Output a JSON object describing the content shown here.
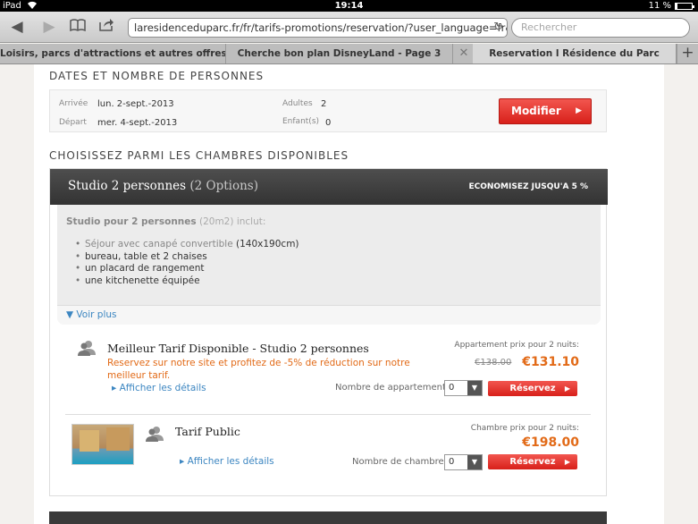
{
  "statusbar": {
    "device": "iPad",
    "time": "19:14",
    "battery": "11 %",
    "battery_level": 0.11
  },
  "toolbar": {
    "url": "laresidenceduparc.fr/fr/tarifs-promotions/reservation/?user_language=fr&",
    "search_placeholder": "Rechercher"
  },
  "tabs": [
    {
      "label": "Loisirs, parcs d'attractions et autres offres -..."
    },
    {
      "label": "Cherche bon plan DisneyLand - Page 3"
    },
    {
      "label": "Reservation l Résidence du Parc"
    }
  ],
  "dates": {
    "section_title": "DATES ET NOMBRE DE PERSONNES",
    "arrival_label": "Arrivée",
    "arrival_value": "lun. 2-sept.-2013",
    "departure_label": "Départ",
    "departure_value": "mer. 4-sept.-2013",
    "adults_label": "Adultes",
    "adults_value": "2",
    "children_label": "Enfant(s)",
    "children_value": "0",
    "modify_label": "Modifier"
  },
  "rooms": {
    "section_title": "CHOISISSEZ PARMI LES CHAMBRES DISPONIBLES",
    "header_title": "Studio 2 personnes",
    "header_options": "(2 Options)",
    "header_promo": "ECONOMISEZ JUSQU'A 5 %",
    "desc_name": "Studio pour 2 personnes",
    "desc_size": "(20m2)",
    "desc_suffix": "inclut:",
    "features": [
      {
        "a": "Séjour avec canapé convertible",
        "b": " (140x190cm)"
      },
      {
        "a": "",
        "b": "bureau, table et 2 chaises"
      },
      {
        "a": "",
        "b": "un placard de rangement"
      },
      {
        "a": "",
        "b": "une kitchenette équipée"
      }
    ],
    "see_more": "Voir plus"
  },
  "rate1": {
    "title": "Meilleur Tarif Disponible - Studio 2 personnes",
    "desc": "Reservez sur notre site et profitez de -5% de réduction sur notre meilleur tarif.",
    "details": "Afficher les détails",
    "price_label": "Appartement prix pour 2 nuits:",
    "price_old": "€138.00",
    "price_new": "€131.10",
    "qty_label": "Nombre de appartements",
    "qty_value": "0",
    "book": "Réservez"
  },
  "rate2": {
    "title": "Tarif Public",
    "details": "Afficher les détails",
    "price_label": "Chambre prix pour 2 nuits:",
    "price_new": "€198.00",
    "qty_label": "Nombre de chambres",
    "qty_value": "0",
    "book": "Réservez"
  }
}
